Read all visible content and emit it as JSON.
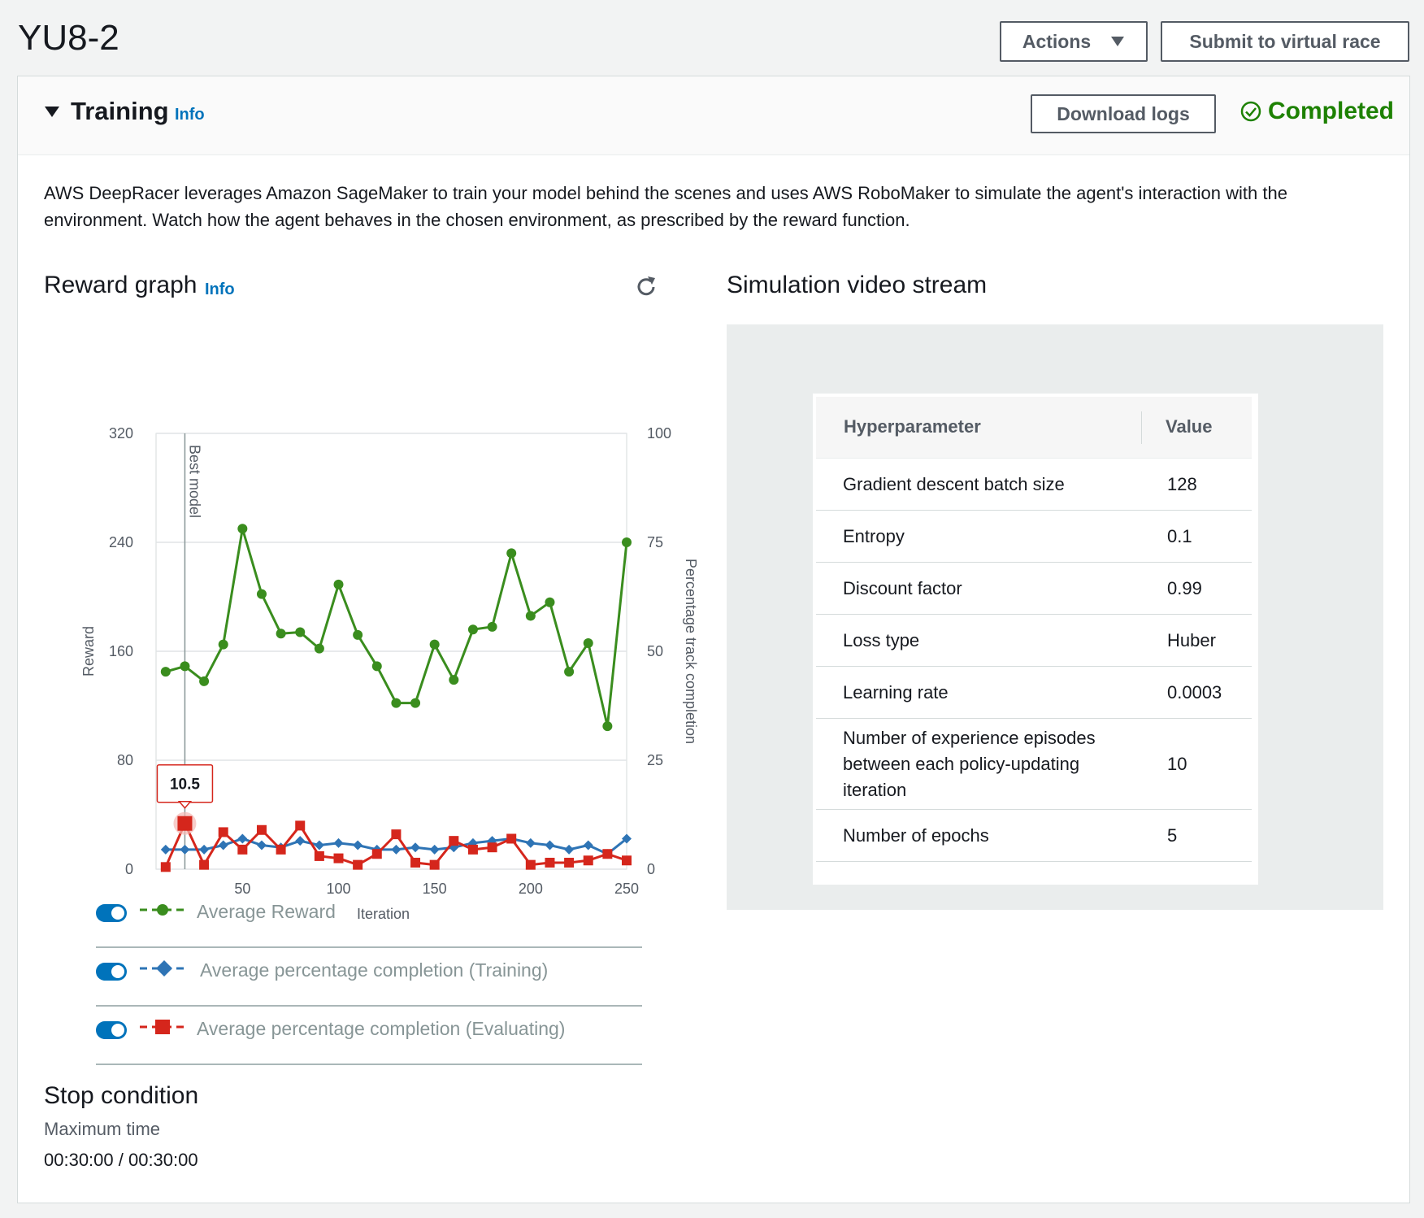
{
  "page": {
    "title": "YU8-2",
    "actions_label": "Actions",
    "submit_label": "Submit to virtual race"
  },
  "training": {
    "title": "Training",
    "info_label": "Info",
    "download_label": "Download logs",
    "status": "Completed",
    "description": "AWS DeepRacer leverages Amazon SageMaker to train your model behind the scenes and uses AWS RoboMaker to simulate the agent's interaction with the environment. Watch how the agent behaves in the chosen environment, as prescribed by the reward function."
  },
  "reward_graph": {
    "title": "Reward graph",
    "info_label": "Info",
    "best_model_label": "Best model",
    "tooltip_value": "10.5"
  },
  "legend": [
    {
      "label": "Average Reward",
      "color": "#3a8d1e",
      "marker": "circle",
      "enabled": true
    },
    {
      "label": "Average percentage completion (Training)",
      "color": "#2e74b5",
      "marker": "diamond",
      "enabled": true
    },
    {
      "label": "Average percentage completion (Evaluating)",
      "color": "#d5261c",
      "marker": "square",
      "enabled": true
    }
  ],
  "chart_data": {
    "type": "line",
    "xlabel": "Iteration",
    "ylabel": "Reward",
    "y2label": "Percentage track completion",
    "xlim": [
      5,
      250
    ],
    "ylim": [
      0,
      320
    ],
    "y2lim": [
      0,
      100
    ],
    "xticks": [
      50,
      100,
      150,
      200,
      250
    ],
    "yticks": [
      0,
      80,
      160,
      240,
      320
    ],
    "y2ticks": [
      0,
      25,
      50,
      75,
      100
    ],
    "best_model_x": 20,
    "grid": true,
    "series": [
      {
        "name": "Average Reward",
        "axis": "left",
        "color": "#3a8d1e",
        "marker": "circle",
        "x": [
          10,
          20,
          30,
          40,
          50,
          60,
          70,
          80,
          90,
          100,
          110,
          120,
          130,
          140,
          150,
          160,
          170,
          180,
          190,
          200,
          210,
          220,
          230,
          240,
          250
        ],
        "values": [
          145,
          149,
          138,
          165,
          250,
          202,
          173,
          174,
          162,
          209,
          172,
          149,
          122,
          122,
          165,
          139,
          176,
          178,
          232,
          186,
          196,
          145,
          166,
          105,
          240
        ]
      },
      {
        "name": "Average percentage completion (Training)",
        "axis": "right",
        "color": "#2e74b5",
        "marker": "diamond",
        "x": [
          10,
          20,
          30,
          40,
          50,
          60,
          70,
          80,
          90,
          100,
          110,
          120,
          130,
          140,
          150,
          160,
          170,
          180,
          190,
          200,
          210,
          220,
          230,
          240,
          250
        ],
        "values": [
          4.5,
          4.5,
          4.5,
          5.5,
          7,
          5.5,
          5,
          6.5,
          5.5,
          6,
          5.5,
          4.5,
          4.5,
          5,
          4.5,
          5,
          6,
          6.5,
          7,
          6,
          5.5,
          4.5,
          5.5,
          3.5,
          7
        ]
      },
      {
        "name": "Average percentage completion (Evaluating)",
        "axis": "right",
        "color": "#d5261c",
        "marker": "square",
        "x": [
          10,
          20,
          30,
          40,
          50,
          60,
          70,
          80,
          90,
          100,
          110,
          120,
          130,
          140,
          150,
          160,
          170,
          180,
          190,
          200,
          210,
          220,
          230,
          240,
          250
        ],
        "values": [
          0.5,
          10.5,
          1,
          8.5,
          4.5,
          9,
          4.5,
          10,
          3,
          2.5,
          1,
          3.5,
          8,
          1.5,
          1,
          6.5,
          4.5,
          5,
          7,
          1,
          1.5,
          1.5,
          2,
          3.5,
          2
        ]
      }
    ]
  },
  "simulation": {
    "title": "Simulation video stream",
    "table_headers": [
      "Hyperparameter",
      "Value"
    ],
    "rows": [
      {
        "name": "Gradient descent batch size",
        "value": "128"
      },
      {
        "name": "Entropy",
        "value": "0.1"
      },
      {
        "name": "Discount factor",
        "value": "0.99"
      },
      {
        "name": "Loss type",
        "value": "Huber"
      },
      {
        "name": "Learning rate",
        "value": "0.0003"
      },
      {
        "name": "Number of experience episodes between each policy-updating iteration",
        "value": "10"
      },
      {
        "name": "Number of epochs",
        "value": "5"
      }
    ]
  },
  "stop_condition": {
    "title": "Stop condition",
    "label": "Maximum time",
    "value": "00:30:00 / 00:30:00"
  }
}
